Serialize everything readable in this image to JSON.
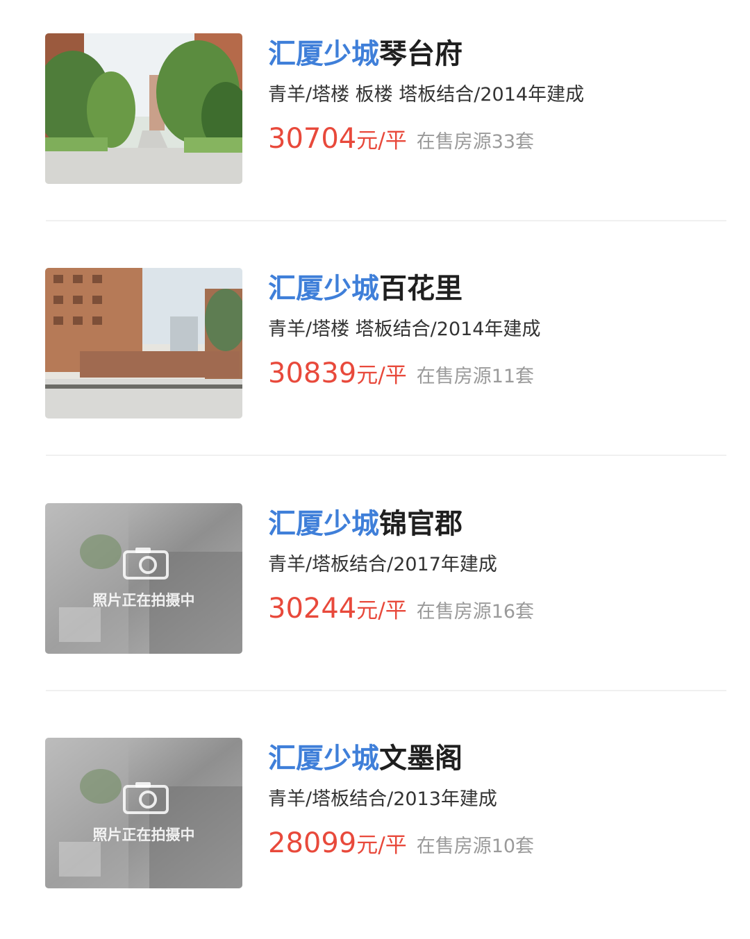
{
  "listings": [
    {
      "name_prefix": "汇厦少城",
      "name_suffix": "琴台府",
      "tags": "青羊/塔楼 板楼 塔板结合/2014年建成",
      "price": "30704",
      "unit": "元/平",
      "stock": "在售房源33套",
      "photo": "residential-courtyard-photo"
    },
    {
      "name_prefix": "汇厦少城",
      "name_suffix": "百花里",
      "tags": "青羊/塔楼 塔板结合/2014年建成",
      "price": "30839",
      "unit": "元/平",
      "stock": "在售房源11套",
      "photo": "residential-entrance-photo"
    },
    {
      "name_prefix": "汇厦少城",
      "name_suffix": "锦官郡",
      "tags": "青羊/塔板结合/2017年建成",
      "price": "30244",
      "unit": "元/平",
      "stock": "在售房源16套",
      "photo": "photo-placeholder",
      "placeholder_text": "照片正在拍摄中"
    },
    {
      "name_prefix": "汇厦少城",
      "name_suffix": "文墨阁",
      "tags": "青羊/塔板结合/2013年建成",
      "price": "28099",
      "unit": "元/平",
      "stock": "在售房源10套",
      "photo": "photo-placeholder",
      "placeholder_text": "照片正在拍摄中"
    }
  ],
  "colors": {
    "name_highlight": "#3f7fd9",
    "name_text": "#1f1f1f",
    "price": "#e8493b",
    "stock": "#9a9a9a",
    "tags": "#333333"
  }
}
